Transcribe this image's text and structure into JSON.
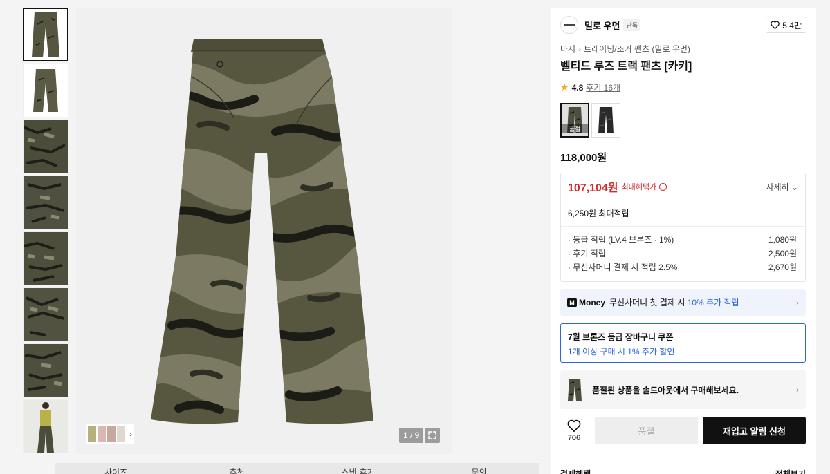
{
  "gallery": {
    "thumbnails": [
      "pants-front",
      "pants-back",
      "fabric-detail",
      "waist-detail",
      "pocket-detail",
      "side-detail",
      "hem-detail",
      "model-shot"
    ],
    "pager": "1 / 9"
  },
  "tabs": [
    "사이즈",
    "추천",
    "스냅·후기",
    "문의"
  ],
  "brand": {
    "name": "밀로 우먼",
    "badge": "단독",
    "likes": "5.4만"
  },
  "breadcrumb": {
    "category": "바지",
    "subcategory": "트레이닝/조거 팬츠 (밀로 우먼)"
  },
  "product": {
    "title": "벨티드 루즈 트랙 팬츠 [카키]",
    "rating": "4.8",
    "reviews": "후기 16개",
    "sold_label": "품절",
    "original_price": "118,000원"
  },
  "benefit": {
    "sale_price": "107,104원",
    "max_label": "최대혜택가",
    "detail": "자세히",
    "points_total": "6,250원 최대적립",
    "rows": [
      {
        "label": "· 등급 적립 (LV.4 브론즈 · 1%)",
        "value": "1,080원"
      },
      {
        "label": "· 후기 적립",
        "value": "2,500원"
      },
      {
        "label": "· 무신사머니 결제 시 적립 2.5%",
        "value": "2,670원"
      }
    ]
  },
  "money": {
    "logo": "M",
    "brand": "Money",
    "text": "무신사머니 첫 결제 시",
    "highlight": "10% 추가 적립"
  },
  "coupon": {
    "title": "7월 브론즈 등급 장바구니 쿠폰",
    "sub": "1개 이상 구매 시 1% 추가 할인"
  },
  "soldout_banner": "품절된 상품을 솔드아웃에서 구매해보세요.",
  "actions": {
    "wish_count": "706",
    "soldout_btn": "품절",
    "restock_btn": "재입고 알림 신청"
  },
  "payment": {
    "label": "결제혜택",
    "more": "전체보기"
  },
  "colors": {
    "khaki": "#4e4f3e",
    "accent_red": "#d62b2b",
    "accent_blue": "#2b66d9"
  }
}
